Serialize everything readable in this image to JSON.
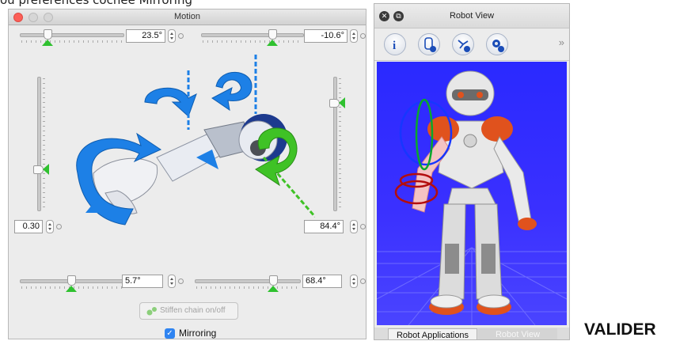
{
  "caption": {
    "text": "ou preferences cochée Mirroring"
  },
  "motion_window": {
    "title": "Motion",
    "sliders": {
      "top_left_value": "23.5°",
      "top_right_value": "-10.6°",
      "left_value": "0.30",
      "right_value": "84.4°",
      "bottom_left_value": "5.7°",
      "bottom_right_value": "68.4°"
    },
    "stiffen_button_label": "Stiffen chain on/off",
    "mirroring_label": "Mirroring",
    "mirroring_checked": true
  },
  "robot_view_window": {
    "title": "Robot View",
    "toolbar_icons": [
      "info-icon",
      "robot-state-icon",
      "joint-disable-icon",
      "settings-disable-icon"
    ],
    "tabs": {
      "applications": "Robot Applications",
      "view": "Robot View"
    }
  },
  "valider": "VALIDER",
  "colors": {
    "viewport_blue": "#3a30ff",
    "slider_green": "#2fc12f",
    "arrow_blue": "#1b7fe0",
    "robot_orange": "#e0521d"
  }
}
